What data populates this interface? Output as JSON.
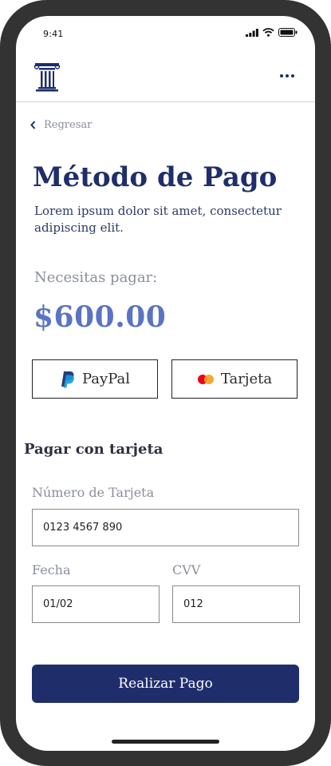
{
  "status_bar": {
    "time": "9:41"
  },
  "nav": {
    "back_label": "Regresar"
  },
  "page": {
    "title": "Método de Pago",
    "subtitle": "Lorem ipsum dolor sit amet, consectetur adipiscing elit.",
    "pay_label": "Necesitas pagar:",
    "amount": "$600.00"
  },
  "methods": {
    "paypal_label": "PayPal",
    "card_label": "Tarjeta"
  },
  "card_form": {
    "section_title": "Pagar con tarjeta",
    "number_label": "Número de Tarjeta",
    "number_value": "0123 4567 890",
    "date_label": "Fecha",
    "date_value": "01/02",
    "cvv_label": "CVV",
    "cvv_value": "012"
  },
  "submit_label": "Realizar Pago",
  "colors": {
    "primary": "#1f2e6b",
    "amount": "#5b73c3",
    "muted": "#8a8f99"
  },
  "icons": [
    "column-logo-icon",
    "more-dots-icon",
    "chevron-left-icon",
    "paypal-icon",
    "mastercard-icon",
    "signal-icon",
    "wifi-icon",
    "battery-icon"
  ]
}
